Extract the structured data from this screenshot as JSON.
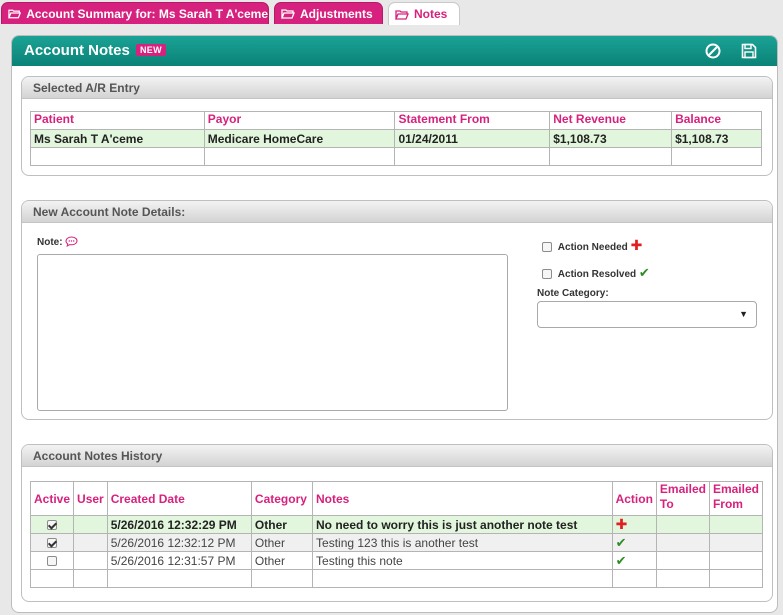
{
  "tabs": [
    {
      "label": "Account Summary for:  Ms Sarah T A'ceme",
      "state": "inactive"
    },
    {
      "label": "Adjustments",
      "state": "inactive"
    },
    {
      "label": "Notes",
      "state": "active"
    }
  ],
  "panel": {
    "title": "Account Notes",
    "badge": "NEW",
    "icons": [
      "cancel-icon",
      "save-icon"
    ]
  },
  "ar_entry": {
    "title": "Selected A/R Entry",
    "columns": [
      "Patient",
      "Payor",
      "Statement From",
      "Net Revenue",
      "Balance"
    ],
    "rows": [
      [
        "Ms Sarah T A'ceme",
        "Medicare HomeCare",
        "01/24/2011",
        "$1,108.73",
        "$1,108.73"
      ]
    ]
  },
  "new_note": {
    "title": "New Account Note Details:",
    "note_label": "Note:",
    "note_value": "",
    "action_needed_label": "Action Needed",
    "action_resolved_label": "Action Resolved",
    "category_label": "Note Category:",
    "category_value": ""
  },
  "history": {
    "title": "Account Notes History",
    "columns": [
      "Active",
      "User",
      "Created Date",
      "Category",
      "Notes",
      "Action",
      "Emailed To",
      "Emailed From"
    ],
    "rows": [
      {
        "active": true,
        "user": "",
        "created": "5/26/2016 12:32:29 PM",
        "category": "Other",
        "notes": "No need to worry this is just another note test",
        "action": "plus",
        "emailed_to": "",
        "emailed_from": ""
      },
      {
        "active": true,
        "user": "",
        "created": "5/26/2016 12:32:12 PM",
        "category": "Other",
        "notes": "Testing 123 this is another test",
        "action": "check",
        "emailed_to": "",
        "emailed_from": ""
      },
      {
        "active": false,
        "user": "",
        "created": "5/26/2016 12:31:57 PM",
        "category": "Other",
        "notes": "Testing this note",
        "action": "check",
        "emailed_to": "",
        "emailed_from": ""
      }
    ]
  },
  "colors": {
    "accent_pink": "#d6217e",
    "header_teal": "#0f8a7e",
    "highlight_green": "#e2f6dd"
  }
}
